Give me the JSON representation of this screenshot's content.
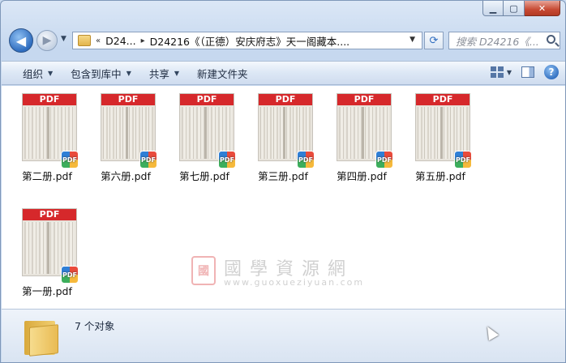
{
  "window": {
    "caption": {
      "minimize": "▁",
      "maximize": "▢",
      "close": "✕"
    }
  },
  "nav": {
    "back_icon": "◀",
    "forward_icon": "▶",
    "dropdown_icon": "▼"
  },
  "address": {
    "chevrons": "«",
    "crumb_1": "D24...",
    "crumb_sep": "▸",
    "crumb_2": "D24216《（正德）安庆府志》天一阁藏本....",
    "dropdown_icon": "▼",
    "refresh_icon": "⟳"
  },
  "search": {
    "placeholder": "搜索 D24216《..."
  },
  "toolbar": {
    "organize": "组织",
    "include_library": "包含到库中",
    "share": "共享",
    "new_folder": "新建文件夹",
    "arrow": "▼",
    "help": "?"
  },
  "files": [
    {
      "name": "第二册.pdf",
      "banner": "PDF",
      "badge": "PDF"
    },
    {
      "name": "第六册.pdf",
      "banner": "PDF",
      "badge": "PDF"
    },
    {
      "name": "第七册.pdf",
      "banner": "PDF",
      "badge": "PDF"
    },
    {
      "name": "第三册.pdf",
      "banner": "PDF",
      "badge": "PDF"
    },
    {
      "name": "第四册.pdf",
      "banner": "PDF",
      "badge": "PDF"
    },
    {
      "name": "第五册.pdf",
      "banner": "PDF",
      "badge": "PDF"
    },
    {
      "name": "第一册.pdf",
      "banner": "PDF",
      "badge": "PDF"
    }
  ],
  "watermark": {
    "seal": "國",
    "title": "國學資源網",
    "url": "www.guoxueziyuan.com"
  },
  "status": {
    "item_count": "7 个对象"
  },
  "colors": {
    "pdf_red": "#d6282b",
    "window_frame": "#c6d8ef",
    "accent_blue": "#2f6dbf"
  }
}
